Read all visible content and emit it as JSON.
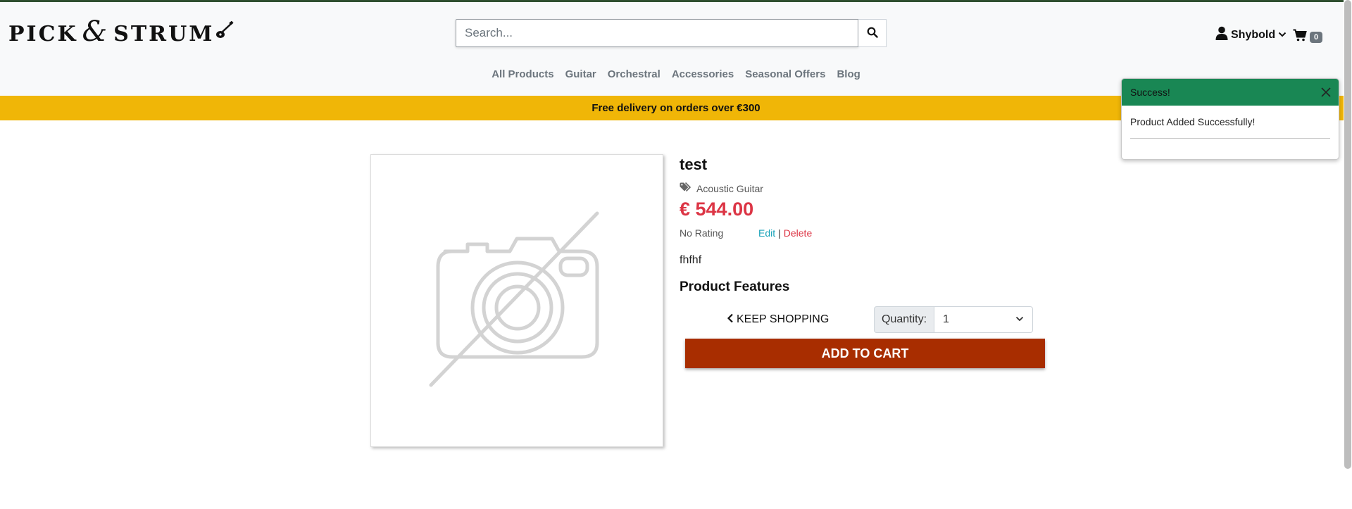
{
  "brand": {
    "logo_part1": "PICK",
    "logo_amp": "&",
    "logo_part2": "STRUM"
  },
  "search": {
    "placeholder": "Search...",
    "value": ""
  },
  "account": {
    "username": "Shybold"
  },
  "cart": {
    "count": "0"
  },
  "nav": {
    "items": [
      "All Products",
      "Guitar",
      "Orchestral",
      "Accessories",
      "Seasonal Offers",
      "Blog"
    ]
  },
  "banner": {
    "text": "Free delivery on orders over €300"
  },
  "product": {
    "name": "test",
    "category": "Acoustic Guitar",
    "price": "€ 544.00",
    "rating": "No Rating",
    "edit_label": "Edit",
    "separator": "|",
    "delete_label": "Delete",
    "description": "fhfhf",
    "features_heading": "Product Features",
    "keep_shopping_label": "KEEP SHOPPING",
    "quantity_label": "Quantity:",
    "quantity_value": "1",
    "add_to_cart_label": "ADD TO CART"
  },
  "toast": {
    "title": "Success!",
    "message": "Product Added Successfully!"
  },
  "colors": {
    "banner": "#f0b607",
    "price": "#dc3545",
    "add_to_cart": "#a82d00",
    "toast_header": "#198754",
    "edit_link": "#17a2b8"
  },
  "icons": {
    "search": "search-icon",
    "user": "user-icon",
    "chevron": "chevron-down-icon",
    "cart": "cart-icon",
    "tags": "tags-icon",
    "keep_shopping": "chevron-left-icon",
    "close": "close-icon",
    "placeholder_image": "no-image-camera-icon"
  }
}
